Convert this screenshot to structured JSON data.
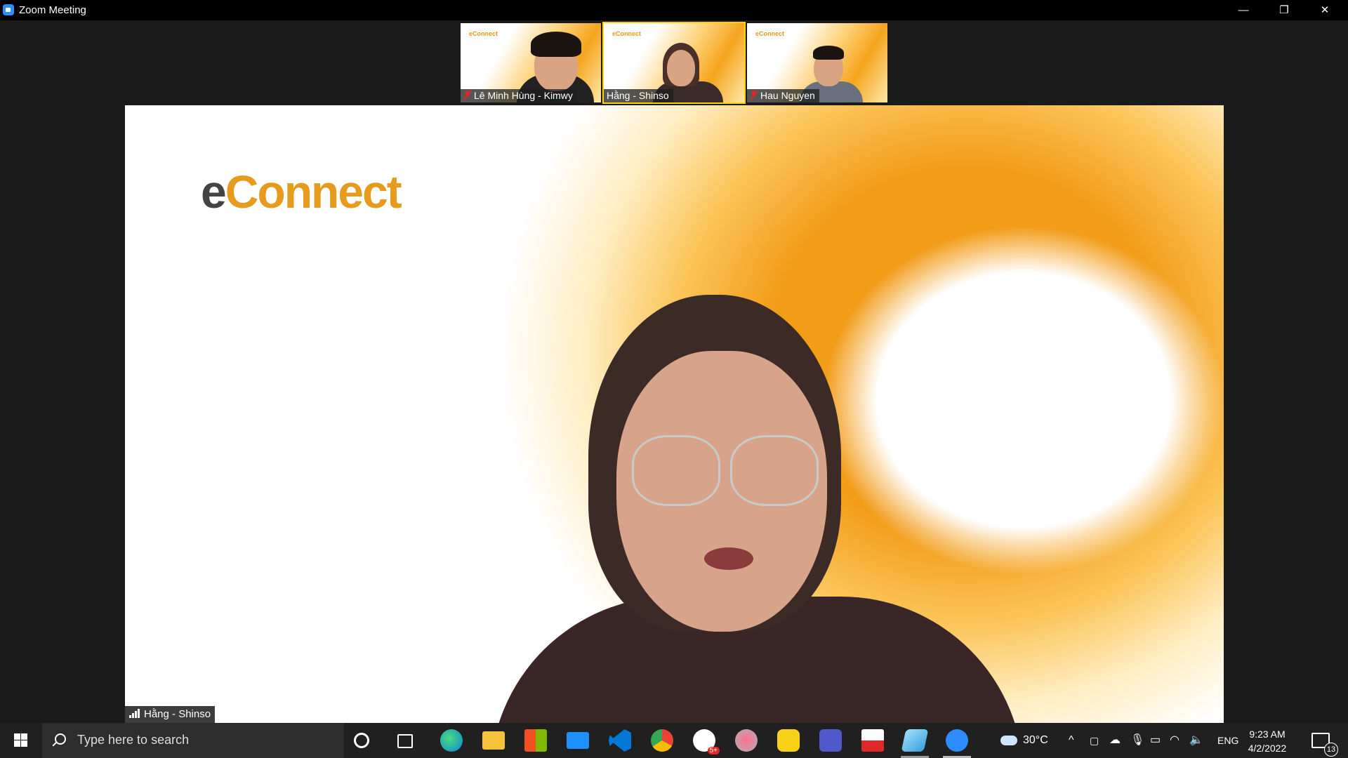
{
  "window": {
    "title": "Zoom Meeting",
    "minimize": "—",
    "restore": "❐",
    "close": "✕"
  },
  "thumbnails": [
    {
      "name": "Lê Minh Hùng - Kimwy",
      "logo": "eConnect",
      "muted": true
    },
    {
      "name": "Hằng - Shinso",
      "logo": "eConnect",
      "muted": false,
      "active": true
    },
    {
      "name": "Hau Nguyen",
      "logo": "eConnect",
      "muted": true
    }
  ],
  "main": {
    "logo_e": "e",
    "logo_rest": "Connect",
    "speaker_name": "Hằng - Shinso"
  },
  "taskbar": {
    "search_placeholder": "Type here to search",
    "weather": "30°C",
    "language": "ENG",
    "time": "9:23 AM",
    "date": "4/2/2022",
    "notification_count": "13",
    "skype_badge": "5+",
    "apps": [
      "cortana-icon",
      "task-view-icon",
      "edge-icon",
      "file-explorer-icon",
      "store-icon",
      "mail-icon",
      "vscode-icon",
      "chrome-icon",
      "skype-icon",
      "paint-icon",
      "dev-icon",
      "teams-icon",
      "snip-icon",
      "notepad-icon",
      "zoom-icon"
    ]
  },
  "colors": {
    "accent_orange": "#f29c18",
    "active_border": "#ffd200",
    "muted_red": "#e02828",
    "zoom_blue": "#2d8cff"
  }
}
